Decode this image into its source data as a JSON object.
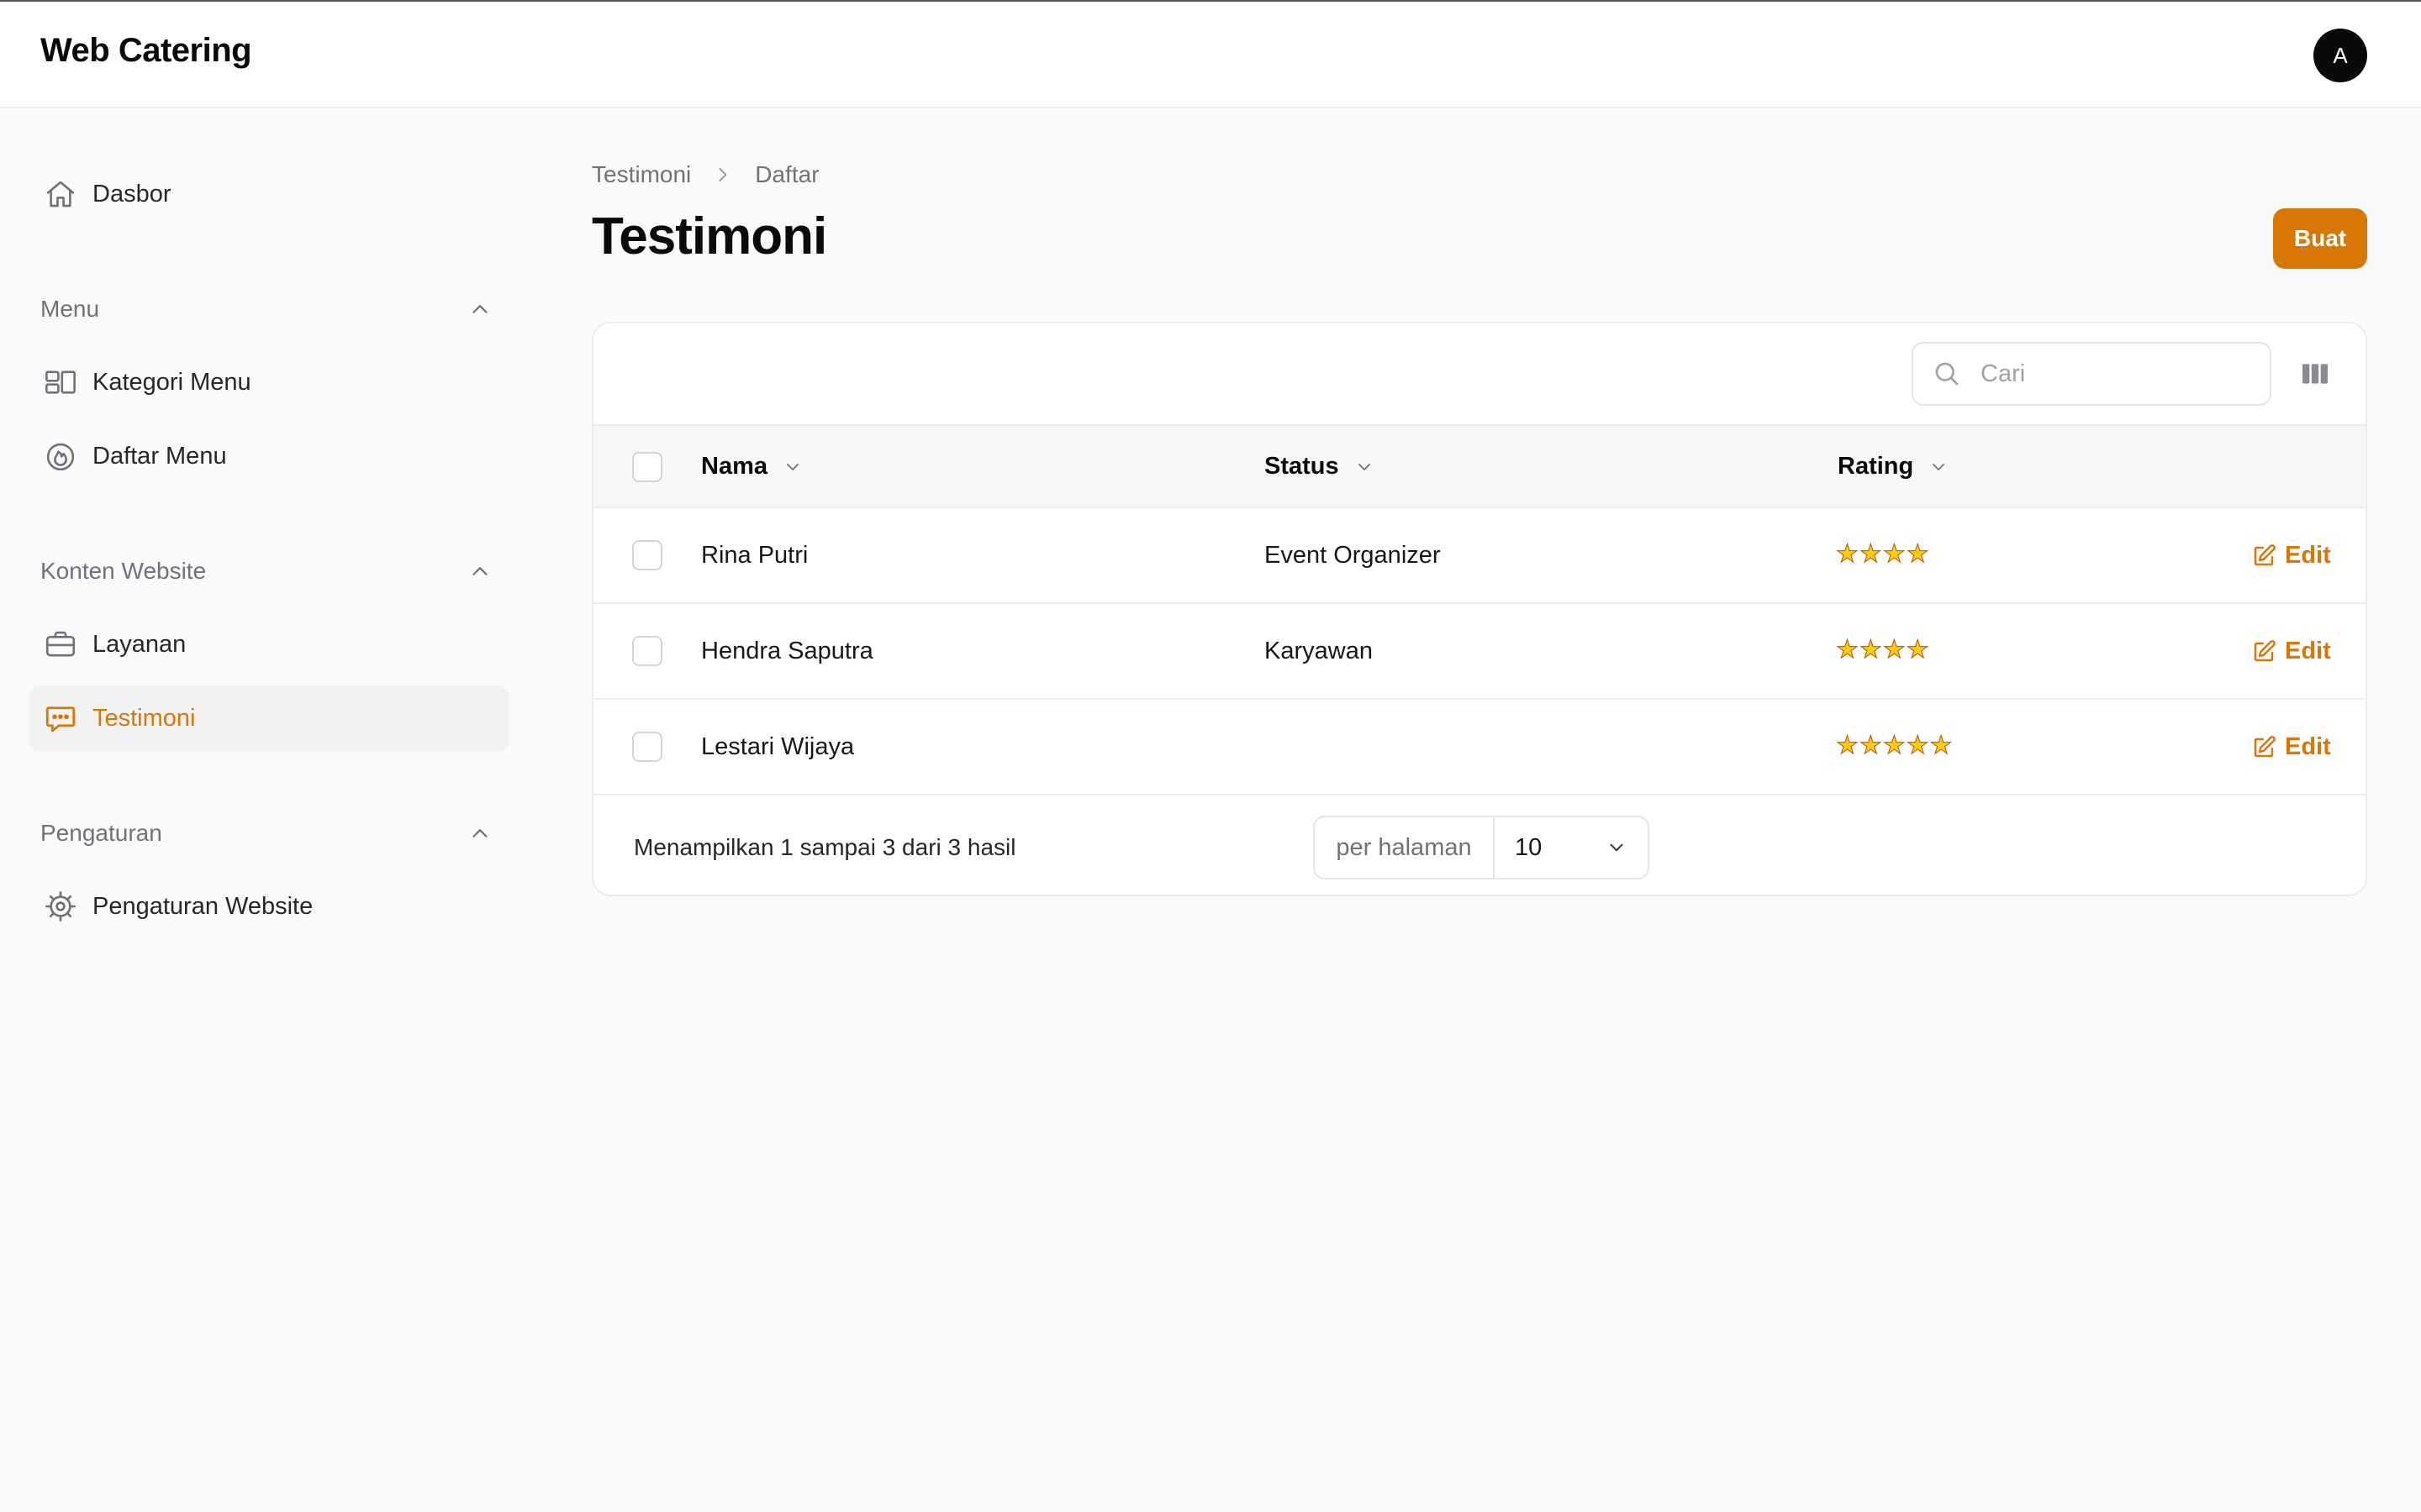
{
  "app": {
    "brand": "Web Catering",
    "avatar_initial": "A"
  },
  "sidebar": {
    "dashboard": {
      "label": "Dasbor",
      "icon": "home-icon"
    },
    "groups": [
      {
        "label": "Menu",
        "items": [
          {
            "label": "Kategori Menu",
            "icon": "layout-icon"
          },
          {
            "label": "Daftar Menu",
            "icon": "fire-icon"
          }
        ]
      },
      {
        "label": "Konten Website",
        "items": [
          {
            "label": "Layanan",
            "icon": "briefcase-icon"
          },
          {
            "label": "Testimoni",
            "icon": "chat-bubble-icon",
            "active": true
          }
        ]
      },
      {
        "label": "Pengaturan",
        "items": [
          {
            "label": "Pengaturan Website",
            "icon": "cog-icon"
          }
        ]
      }
    ]
  },
  "breadcrumb": [
    "Testimoni",
    "Daftar"
  ],
  "page": {
    "title": "Testimoni",
    "create_label": "Buat"
  },
  "search": {
    "placeholder": "Cari",
    "value": ""
  },
  "table": {
    "columns": [
      "Nama",
      "Status",
      "Rating"
    ],
    "rows": [
      {
        "nama": "Rina Putri",
        "status": "Event Organizer",
        "rating": 4,
        "action": "Edit"
      },
      {
        "nama": "Hendra Saputra",
        "status": "Karyawan",
        "rating": 4,
        "action": "Edit"
      },
      {
        "nama": "Lestari Wijaya",
        "status": "",
        "rating": 5,
        "action": "Edit"
      }
    ]
  },
  "pagination": {
    "summary": "Menampilkan 1 sampai 3 dari 3 hasil",
    "per_page_label": "per halaman",
    "per_page_value": "10"
  },
  "colors": {
    "accent": "#d97706",
    "star": "#facc15"
  }
}
